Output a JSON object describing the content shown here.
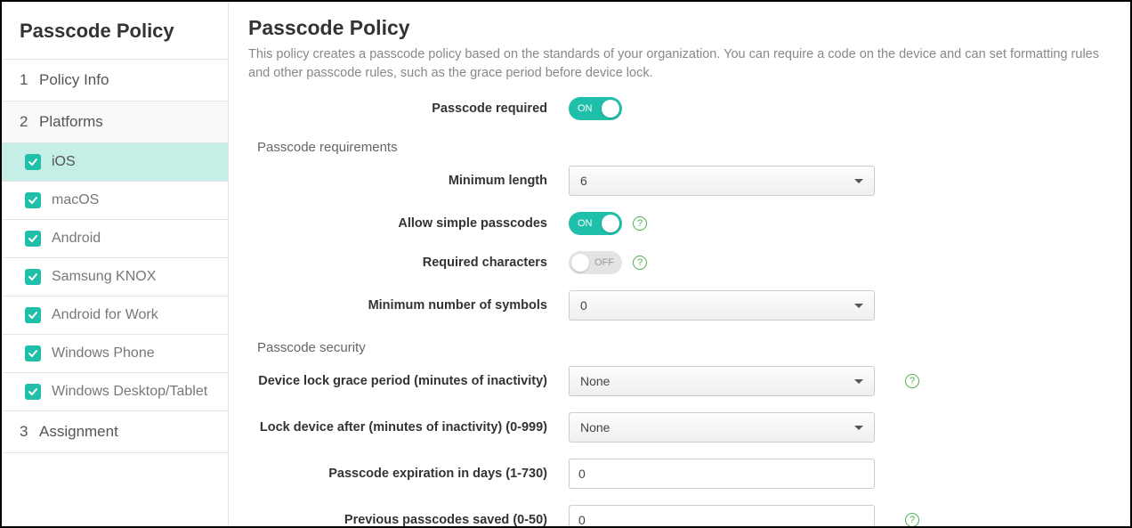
{
  "sidebar": {
    "title": "Passcode Policy",
    "steps": {
      "policy_info": {
        "num": "1",
        "label": "Policy Info"
      },
      "platforms": {
        "num": "2",
        "label": "Platforms"
      },
      "assignment": {
        "num": "3",
        "label": "Assignment"
      }
    },
    "platforms": [
      "iOS",
      "macOS",
      "Android",
      "Samsung KNOX",
      "Android for Work",
      "Windows Phone",
      "Windows Desktop/Tablet"
    ]
  },
  "main": {
    "title": "Passcode Policy",
    "description": "This policy creates a passcode policy based on the standards of your organization. You can require a code on the device and can set formatting rules and other passcode rules, such as the grace period before device lock.",
    "sections": {
      "requirements_header": "Passcode requirements",
      "security_header": "Passcode security"
    },
    "fields": {
      "passcode_required": {
        "label": "Passcode required",
        "value": "ON"
      },
      "minimum_length": {
        "label": "Minimum length",
        "value": "6"
      },
      "allow_simple": {
        "label": "Allow simple passcodes",
        "value": "ON"
      },
      "required_characters": {
        "label": "Required characters",
        "value": "OFF"
      },
      "min_symbols": {
        "label": "Minimum number of symbols",
        "value": "0"
      },
      "grace_period": {
        "label": "Device lock grace period (minutes of inactivity)",
        "value": "None"
      },
      "lock_after": {
        "label": "Lock device after (minutes of inactivity) (0-999)",
        "value": "None"
      },
      "expiration": {
        "label": "Passcode expiration in days (1-730)",
        "value": "0"
      },
      "previous_saved": {
        "label": "Previous passcodes saved (0-50)",
        "value": "0"
      }
    }
  }
}
